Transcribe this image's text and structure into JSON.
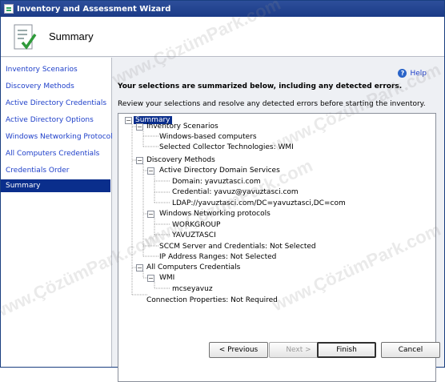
{
  "window": {
    "title": "Inventory and Assessment Wizard"
  },
  "header": {
    "title": "Summary",
    "icon": "checklist-icon"
  },
  "nav": {
    "items": [
      {
        "label": "Inventory Scenarios"
      },
      {
        "label": "Discovery Methods"
      },
      {
        "label": "Active Directory Credentials"
      },
      {
        "label": "Active Directory Options"
      },
      {
        "label": "Windows Networking Protocols"
      },
      {
        "label": "All Computers Credentials"
      },
      {
        "label": "Credentials Order"
      },
      {
        "label": "Summary",
        "selected": true
      }
    ]
  },
  "content": {
    "help_label": "Help",
    "heading": "Your selections are summarized below, including any detected errors.",
    "subheading": "Review your selections and resolve any detected errors before starting the inventory.",
    "tree": {
      "root": "Summary",
      "rows": [
        "Inventory Scenarios",
        "Windows-based computers",
        "Selected Collector Technologies: WMI",
        "Discovery Methods",
        "Active Directory Domain Services",
        "Domain: yavuztasci.com",
        "Credential: yavuz@yavuztasci.com",
        "LDAP://yavuztasci.com/DC=yavuztasci,DC=com",
        "Windows Networking protocols",
        "WORKGROUP",
        "YAVUZTASCI",
        "SCCM Server and Credentials: Not Selected",
        "IP Address Ranges: Not Selected",
        "All Computers Credentials",
        "WMI",
        "mcseyavuz",
        "Connection Properties: Not Required"
      ]
    }
  },
  "footer": {
    "previous": "< Previous",
    "next": "Next >",
    "finish": "Finish",
    "cancel": "Cancel"
  },
  "watermark": "www.ÇözümPark.com",
  "colors": {
    "title_bar": "#1b3a86",
    "selection": "#0a2e8c",
    "link": "#1d3ec9"
  }
}
